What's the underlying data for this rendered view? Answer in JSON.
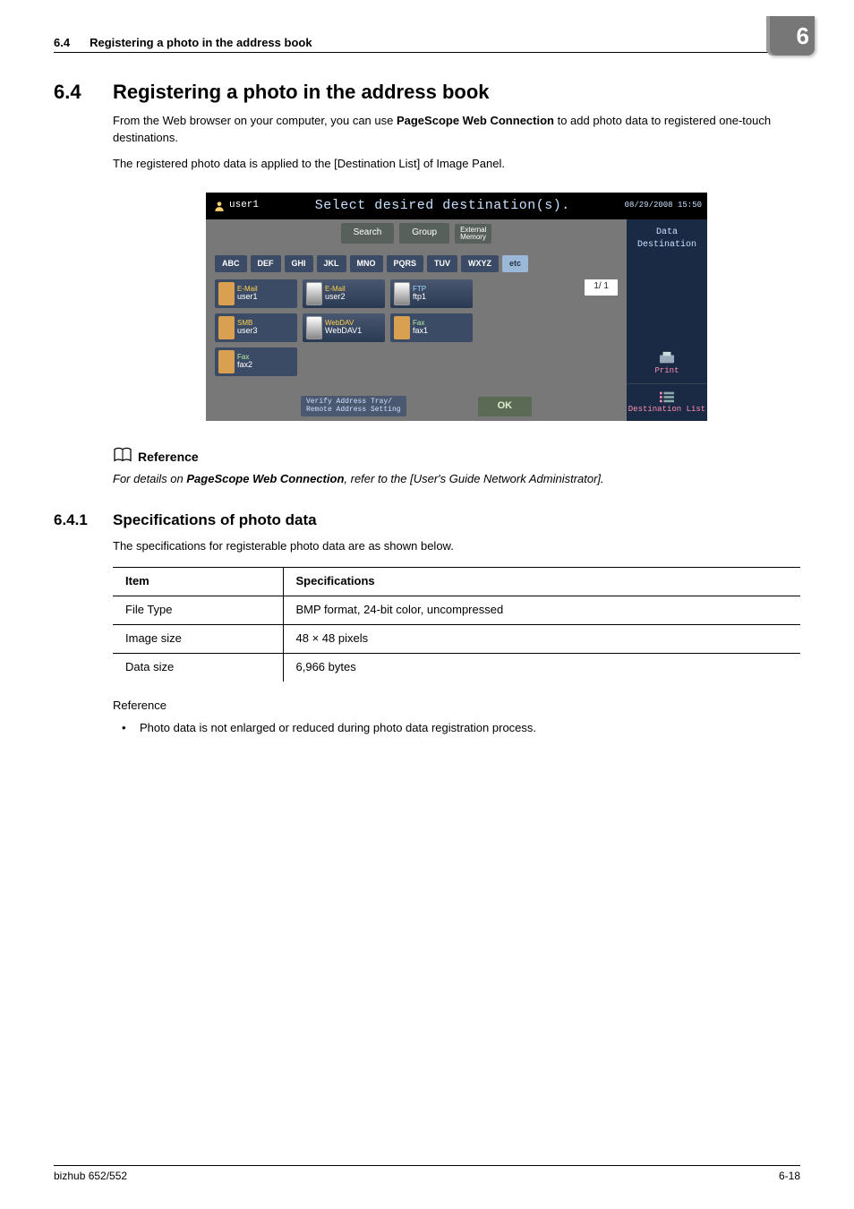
{
  "header": {
    "num": "6.4",
    "title": "Registering a photo in the address book",
    "chapter": "6"
  },
  "section": {
    "num": "6.4",
    "title": "Registering a photo in the address book",
    "para1_pre": "From the Web browser on your computer, you can use ",
    "para1_bold": "PageScope Web Connection",
    "para1_post": " to add photo data to registered one-touch destinations.",
    "para2": "The registered photo data is applied to the [Destination List] of Image Panel."
  },
  "device": {
    "user": "user1",
    "title": "Select desired destination(s).",
    "clock": "08/29/2008 15:50",
    "side": {
      "dataDest": "Data Destination",
      "print": "Print",
      "destList": "Destination List"
    },
    "toolbar": {
      "search": "Search",
      "group": "Group",
      "extMem": "External\nMemory"
    },
    "tabs": [
      "ABC",
      "DEF",
      "GHI",
      "JKL",
      "MNO",
      "PQRS",
      "TUV",
      "WXYZ",
      "etc"
    ],
    "pager": "1/  1",
    "dests": [
      {
        "type": "E-Mail",
        "name": "user1",
        "klass": ""
      },
      {
        "type": "E-Mail",
        "name": "user2",
        "klass": "photo"
      },
      {
        "type": "FTP",
        "name": "ftp1",
        "klass": "photo ftp"
      },
      {
        "type": "SMB",
        "name": "user3",
        "klass": ""
      },
      {
        "type": "WebDAV",
        "name": "WebDAV1",
        "klass": "photo"
      },
      {
        "type": "Fax",
        "name": "fax1",
        "klass": "fax"
      },
      {
        "type": "Fax",
        "name": "fax2",
        "klass": "fax"
      }
    ],
    "verify": "Verify Address Tray/\nRemote Address Setting",
    "ok": "OK"
  },
  "reference1": {
    "heading": "Reference",
    "pre": "For details on ",
    "bold": "PageScope Web Connection",
    "post": ", refer to the [User's Guide Network Administrator]."
  },
  "subsection": {
    "num": "6.4.1",
    "title": "Specifications of photo data",
    "intro": "The specifications for registerable photo data are as shown below.",
    "thItem": "Item",
    "thSpec": "Specifications",
    "rows": [
      {
        "item": "File Type",
        "spec": "BMP format, 24-bit color, uncompressed"
      },
      {
        "item": "Image size",
        "spec": "48 × 48 pixels"
      },
      {
        "item": "Data size",
        "spec": "6,966 bytes"
      }
    ],
    "ref2": "Reference",
    "note": "Photo data is not enlarged or reduced during photo data registration process."
  },
  "footer": {
    "left": "bizhub 652/552",
    "right": "6-18"
  }
}
